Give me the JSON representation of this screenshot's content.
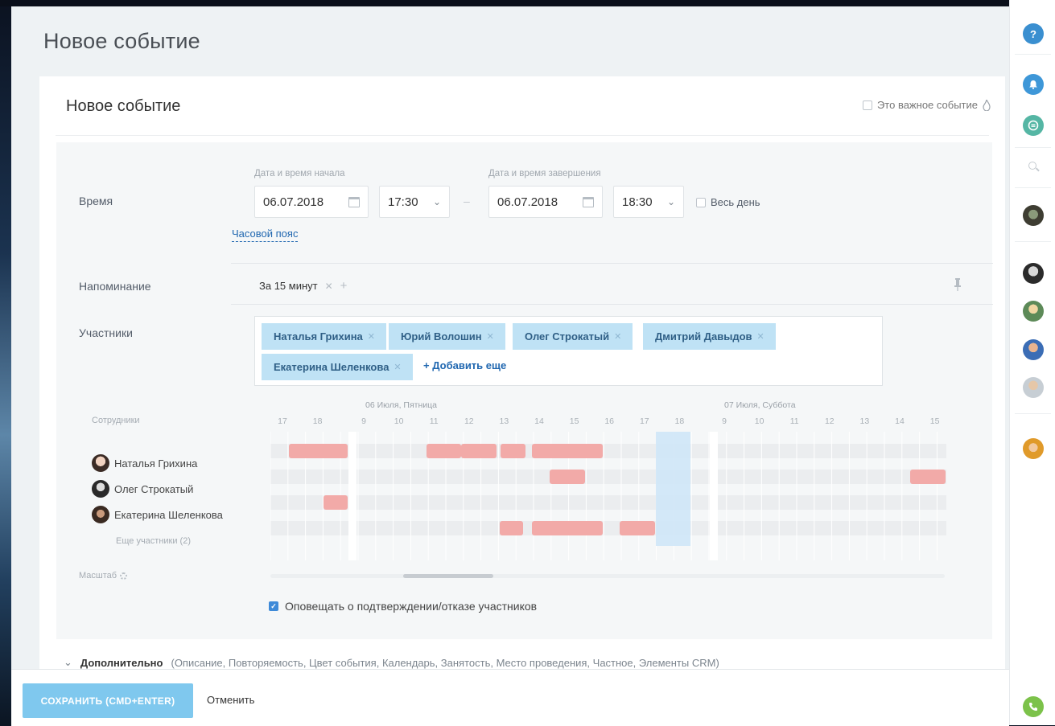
{
  "page": {
    "title": "Новое событие"
  },
  "form": {
    "title": "Новое событие",
    "important_label": "Это важное событие",
    "time": {
      "label": "Время",
      "start_caption": "Дата и время начала",
      "end_caption": "Дата и время завершения",
      "start_date": "06.07.2018",
      "start_time": "17:30",
      "end_date": "06.07.2018",
      "end_time": "18:30",
      "separator": "–",
      "all_day_label": "Весь день",
      "timezone_link": "Часовой пояс"
    },
    "reminder": {
      "label": "Напоминание",
      "value": "За 15 минут"
    },
    "members": {
      "label": "Участники",
      "tags": [
        "Наталья Грихина",
        "Юрий Волошин",
        "Олег Строкатый",
        "Дмитрий Давыдов",
        "Екатерина Шеленкова"
      ],
      "add_more": "+ Добавить еще"
    },
    "planner": {
      "employees_header": "Сотрудники",
      "days": [
        "06 Июля, Пятница",
        "07 Июля, Суббота"
      ],
      "hours_prev": [
        "17",
        "18"
      ],
      "hours_day1": [
        "9",
        "10",
        "11",
        "12",
        "13",
        "14",
        "15",
        "16",
        "17",
        "18"
      ],
      "hours_day2": [
        "9",
        "10",
        "11",
        "12",
        "13",
        "14",
        "15"
      ],
      "people": [
        "Наталья Грихина",
        "Олег Строкатый",
        "Екатерина Шеленкова"
      ],
      "more_members": "Еще участники (2)",
      "scale_label": "Масштаб"
    },
    "notify_label": "Оповещать о подтверждении/отказе участников",
    "notify_checked": true,
    "additional": {
      "label": "Дополнительно",
      "details": "(Описание, Повторяемость, Цвет события, Календарь, Занятость, Место проведения, Частное, Элементы CRM)"
    }
  },
  "footer": {
    "save_label": "СОХРАНИТЬ (CMD+ENTER)",
    "cancel_label": "Отменить"
  },
  "rightbar": {
    "help_glyph": "?"
  },
  "colors": {
    "accent": "#2067b0",
    "tag_bg": "#bfe2f5",
    "busy": "#f2aaa8",
    "selected": "#cfe6f7",
    "save_button": "#7fc8ee",
    "phone": "#7cc24a"
  }
}
